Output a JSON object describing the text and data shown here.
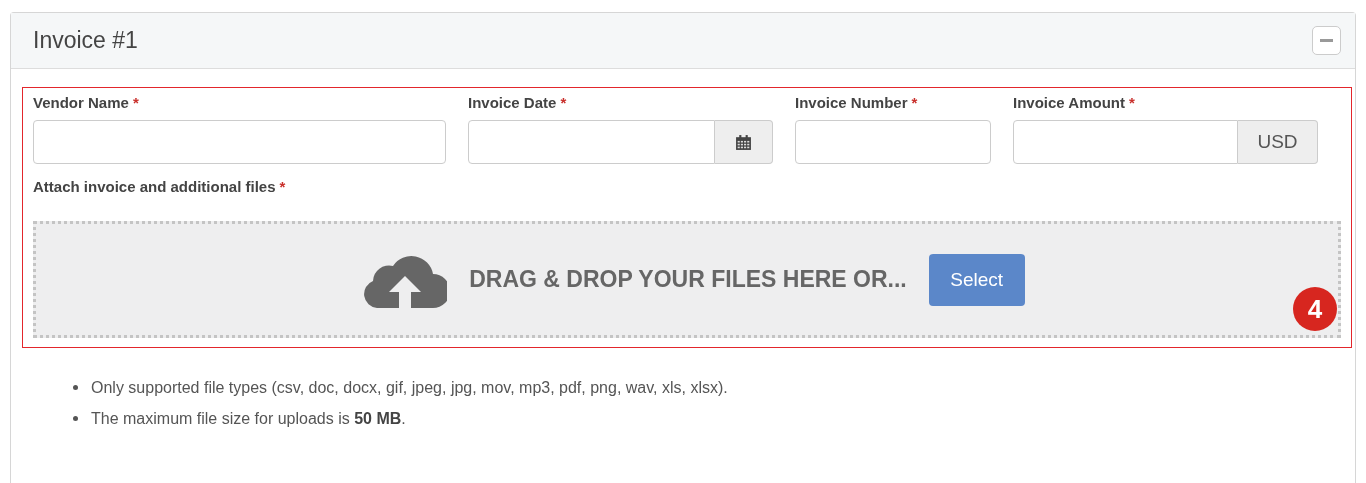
{
  "panel": {
    "title": "Invoice #1",
    "expanded": true
  },
  "fields": [
    {
      "kind": "text",
      "label": "Vendor Name",
      "required_mark": "*"
    },
    {
      "kind": "date",
      "label": "Invoice Date",
      "required_mark": "*"
    },
    {
      "kind": "text",
      "label": "Invoice Number",
      "required_mark": "*"
    },
    {
      "kind": "currency",
      "label": "Invoice Amount",
      "required_mark": "*",
      "addon": "USD"
    }
  ],
  "attachments": {
    "label": "Attach invoice and additional files",
    "required_mark": "*",
    "drop_text": "DRAG & DROP YOUR FILES HERE OR...",
    "button": "Select"
  },
  "callout": {
    "number": "4"
  },
  "notes": [
    "Only supported file types (csv, doc, docx, gif, jpeg, jpg, mov, mp3, pdf, png, wav, xls, xlsx).",
    "The maximum file size for uploads is **50 MB**."
  ]
}
